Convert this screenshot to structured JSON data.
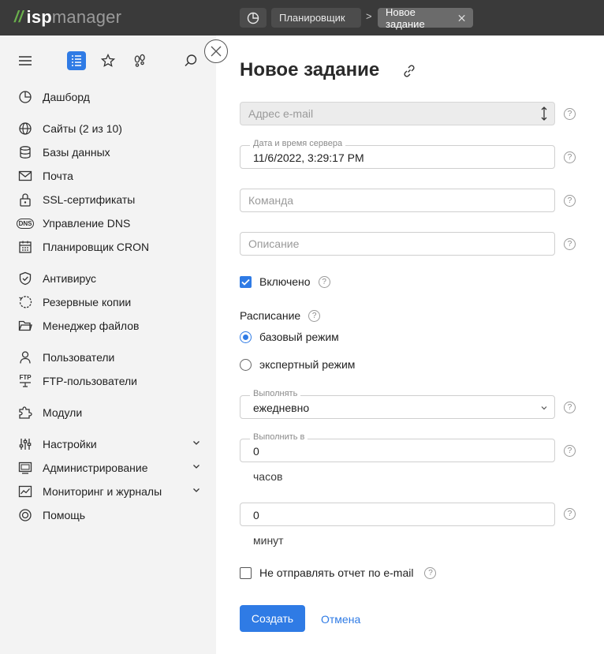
{
  "logo": {
    "part1": "isp",
    "part2": "manager"
  },
  "breadcrumb": {
    "items": [
      "Планировщик",
      "Новое задание"
    ],
    "separator": ">"
  },
  "sidebar": {
    "items": [
      {
        "label": "Дашборд",
        "icon": "dashboard-icon"
      },
      {
        "label": "Сайты (2 из 10)",
        "icon": "globe-icon"
      },
      {
        "label": "Базы данных",
        "icon": "database-icon"
      },
      {
        "label": "Почта",
        "icon": "mail-icon"
      },
      {
        "label": "SSL-сертификаты",
        "icon": "lock-icon"
      },
      {
        "label": "Управление DNS",
        "icon": "dns-icon"
      },
      {
        "label": "Планировщик CRON",
        "icon": "calendar-icon"
      },
      {
        "label": "Антивирус",
        "icon": "shield-icon"
      },
      {
        "label": "Резервные копии",
        "icon": "backup-icon"
      },
      {
        "label": "Менеджер файлов",
        "icon": "folder-icon"
      },
      {
        "label": "Пользователи",
        "icon": "user-icon"
      },
      {
        "label": "FTP-пользователи",
        "icon": "ftp-icon"
      },
      {
        "label": "Модули",
        "icon": "puzzle-icon"
      },
      {
        "label": "Настройки",
        "icon": "sliders-icon"
      },
      {
        "label": "Администрирование",
        "icon": "monitor-icon"
      },
      {
        "label": "Мониторинг и журналы",
        "icon": "chart-icon"
      },
      {
        "label": "Помощь",
        "icon": "lifebuoy-icon"
      }
    ],
    "dns_icon_text": "DNS",
    "ftp_icon_text": "FTP"
  },
  "form": {
    "title": "Новое задание",
    "email": {
      "placeholder": "Адрес e-mail"
    },
    "server_datetime": {
      "label": "Дата и время сервера",
      "value": "11/6/2022, 3:29:17 PM"
    },
    "command": {
      "placeholder": "Команда"
    },
    "description": {
      "placeholder": "Описание"
    },
    "enabled": {
      "label": "Включено",
      "checked": true
    },
    "schedule": {
      "label": "Расписание",
      "options": [
        "базовый режим",
        "экспертный режим"
      ],
      "selected": "базовый режим"
    },
    "run": {
      "label": "Выполнять",
      "value": "ежедневно"
    },
    "run_at": {
      "label": "Выполнить в",
      "hours_value": "0",
      "hours_unit": "часов",
      "minutes_value": "0",
      "minutes_unit": "минут"
    },
    "no_report": {
      "label": "Не отправлять отчет по e-mail",
      "checked": false
    },
    "help_glyph": "?",
    "submit_label": "Создать",
    "cancel_label": "Отмена"
  },
  "colors": {
    "accent": "#2f7be5",
    "topbar": "#3a3a3a",
    "sidebar": "#f3f3f3"
  }
}
